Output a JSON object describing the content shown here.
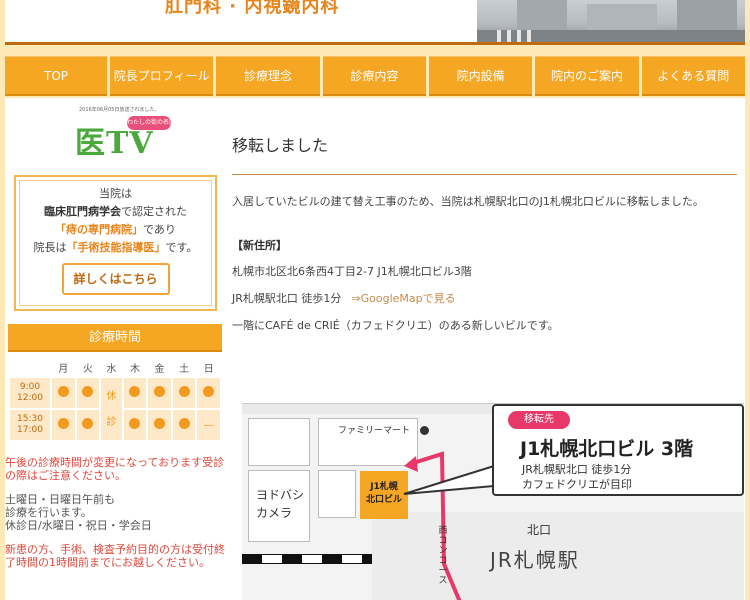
{
  "header": {
    "title": "肛門科 · 内視鏡内科",
    "photo_icon": "street-photo"
  },
  "nav": {
    "items": [
      {
        "label": "TOP"
      },
      {
        "label": "院長プロフィール"
      },
      {
        "label": "診療理念"
      },
      {
        "label": "診療内容"
      },
      {
        "label": "院内設備"
      },
      {
        "label": "院内のご案内"
      },
      {
        "label": "よくある質問"
      }
    ]
  },
  "sidebar": {
    "tv": {
      "caption": "2016年06月05日放送されました。",
      "logo": "医TV",
      "heart_label": "わたしの街の名医"
    },
    "cert": {
      "line1": "当院は",
      "society": "臨床肛門病学会",
      "line2a": "で認定された",
      "hospital": "「痔の専門病院」",
      "line3a": "であり",
      "line4a": "院長は",
      "doctor": "「手術技能指導医」",
      "line4b": "です。",
      "button": "詳しくはこちら"
    },
    "hours": {
      "title": "診療時間",
      "days": [
        "月",
        "火",
        "水",
        "木",
        "金",
        "土",
        "日"
      ],
      "rows": [
        {
          "time1": "9:00",
          "time2": "12:00"
        },
        {
          "time1": "15:30",
          "time2": "17:00"
        }
      ],
      "closed_label_1": "休",
      "closed_label_2": "診",
      "sunday_pm": "—"
    },
    "notes": {
      "red1": "午後の診療時間が変更になっております受診の際はご注意ください。",
      "gray1": "土曜日・日曜日午前も",
      "gray2": "診療を行います。",
      "gray3": "休診日/水曜日・祝日・学会日",
      "red2": "新患の方、手術、検査予約目的の方は受付終了時間の1時間前までにお越しください。"
    }
  },
  "content": {
    "title": "移転しました",
    "intro": "入居していたビルの建て替え工事のため、当院は札幌駅北口のJ1札幌北口ビルに移転しました。",
    "address_label": "【新住所】",
    "address": "札幌市北区北6条西4丁目2-7 J1札幌北口ビル3階",
    "access": "JR札幌駅北口 徒歩1分",
    "map_link": "⇒GoogleMapで見る",
    "building_note": "一階にCAFÉ de CRIÉ（カフェドクリエ）のある新しいビルです。"
  },
  "map": {
    "badge": "移転先",
    "building": "J1札幌北口ビル 3階",
    "sub1": "JR札幌駅北口 徒歩1分",
    "sub2": "カフェドクリエが目印",
    "famima": "ファミリーマート",
    "yodobashi_1": "ヨドバシ",
    "yodobashi_2": "カメラ",
    "j1_1": "J1札幌",
    "j1_2": "北口ビル",
    "kitaguchi": "北口",
    "station": "JR札幌駅",
    "concourse": "西コンコース",
    "route_color": "#e8386a"
  }
}
